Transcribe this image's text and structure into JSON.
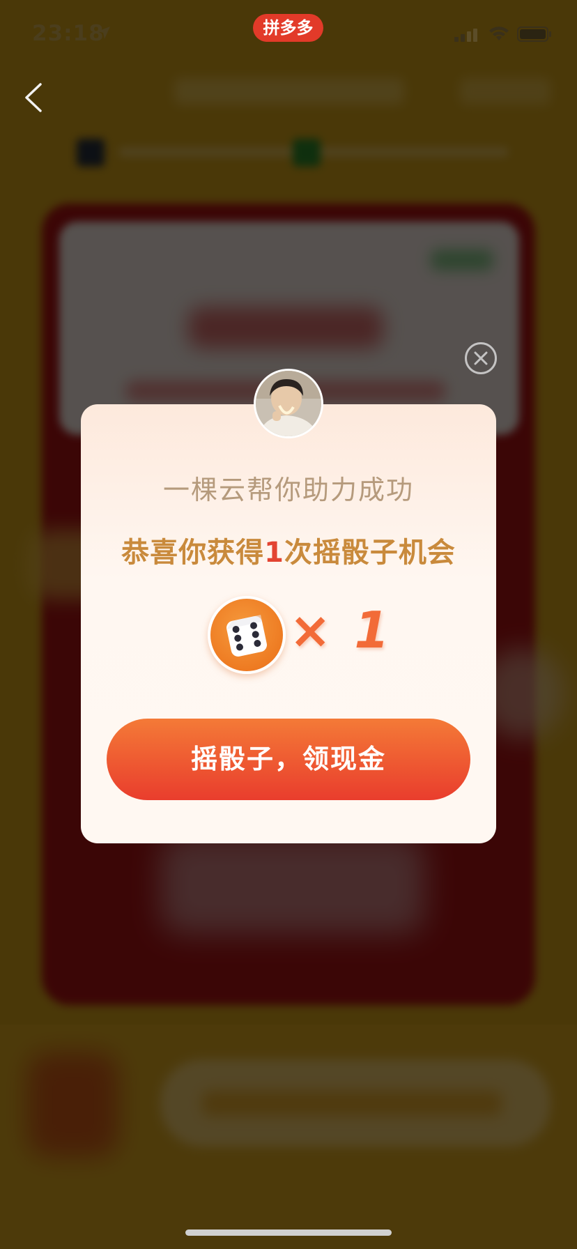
{
  "status_bar": {
    "time": "23:18",
    "app_badge": "拼多多"
  },
  "modal": {
    "helper_text": "一棵云帮你助力成功",
    "congrats_prefix": "恭喜你获得",
    "congrats_count": "1",
    "congrats_suffix": "次摇骰子机会",
    "dice_multiplier": "× 1",
    "cta_label": "摇骰子，领现金"
  },
  "colors": {
    "cta_start": "#f47a37",
    "cta_end": "#e93d2d",
    "accent_red": "#e34432",
    "gold_text": "#c98a3c"
  }
}
